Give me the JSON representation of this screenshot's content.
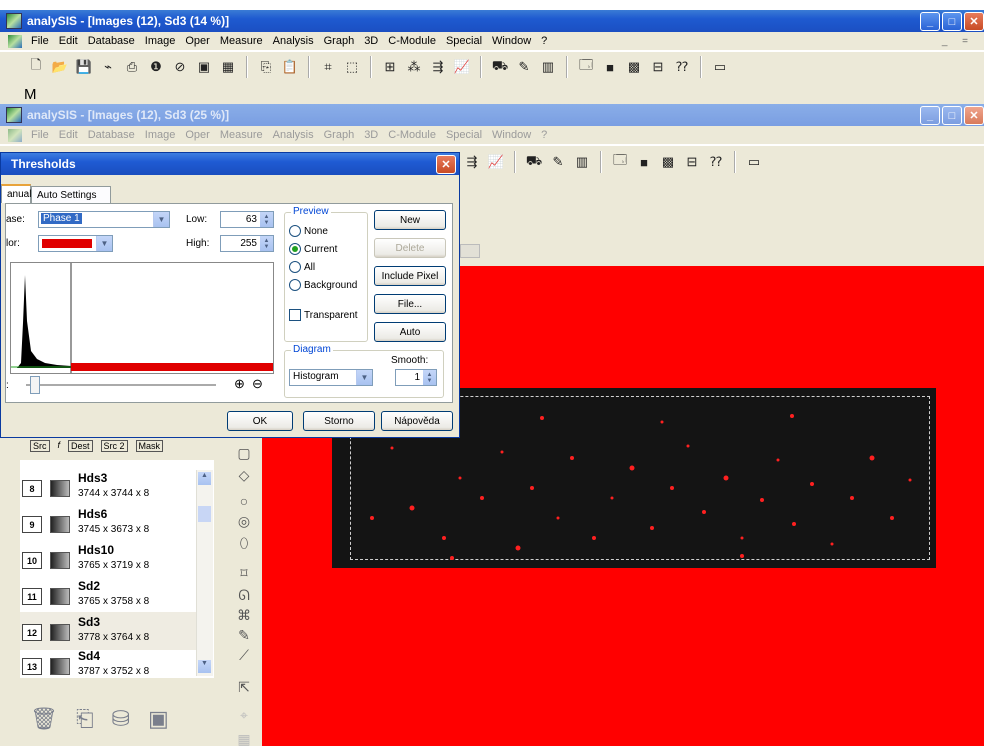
{
  "main_window": {
    "title": "analySIS - [Images (12), Sd3 (14 %)]",
    "menu": [
      "File",
      "Edit",
      "Database",
      "Image",
      "Oper",
      "Measure",
      "Analysis",
      "Graph",
      "3D",
      "C-Module",
      "Special",
      "Window",
      "?"
    ],
    "mdi_buttons": "_ ="
  },
  "second_window": {
    "title": "analySIS - [Images (12), Sd3 (25 %)]",
    "menu": [
      "File",
      "Edit",
      "Database",
      "Image",
      "Oper",
      "Measure",
      "Analysis",
      "Graph",
      "3D",
      "C-Module",
      "Special",
      "Window",
      "?"
    ],
    "partial_label": "M"
  },
  "dialog": {
    "title": "Thresholds",
    "tabs": [
      "anual",
      "Auto Settings"
    ],
    "phase_label": "ase:",
    "phase_value": "Phase 1",
    "color_label": "lor:",
    "low_label": "Low:",
    "low_value": "63",
    "high_label": "High:",
    "high_value": "255",
    "preview_group": "Preview",
    "preview_options": [
      "None",
      "Current",
      "All",
      "Background"
    ],
    "preview_selected": "Current",
    "transparent_label": "Transparent",
    "diagram_group": "Diagram",
    "diagram_value": "Histogram",
    "smooth_label": "Smooth:",
    "smooth_value": "1",
    "buttons": {
      "new": "New",
      "delete": "Delete",
      "include_pixel": "Include Pixel",
      "file": "File...",
      "auto": "Auto"
    },
    "ok": "OK",
    "cancel": "Storno",
    "help": "Nápověda",
    "slider_left_label": ":",
    "zoom_in": "⊕",
    "zoom_out": "⊖",
    "threshold_color": "#e00000"
  },
  "channel_tabs": [
    "Src",
    "Dest",
    "Src 2",
    "Mask"
  ],
  "image_list": [
    {
      "num": "8",
      "name": "Hds3",
      "dims": "3744 x 3744 x 8"
    },
    {
      "num": "9",
      "name": "Hds6",
      "dims": "3745 x 3673 x 8"
    },
    {
      "num": "10",
      "name": "Hds10",
      "dims": "3765 x 3719 x 8"
    },
    {
      "num": "11",
      "name": "Sd2",
      "dims": "3765 x 3758 x 8"
    },
    {
      "num": "12",
      "name": "Sd3",
      "dims": "3778 x 3764 x 8",
      "selected": true
    },
    {
      "num": "13",
      "name": "Sd4",
      "dims": "3787 x 3752 x 8"
    }
  ],
  "colors": {
    "threshold_red": "#ff0000",
    "specimen": "#141414",
    "titlebar": "#1f5bd3"
  }
}
